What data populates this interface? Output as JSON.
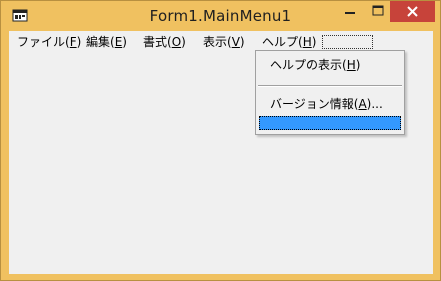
{
  "window": {
    "title": "Form1.MainMenu1",
    "icons": {
      "app": "form-app-icon",
      "minimize": "minimize-icon",
      "maximize": "maximize-icon",
      "close": "close-icon"
    },
    "colors": {
      "frame": "#f0c160",
      "close_button": "#c7433a",
      "client": "#f0f0f0",
      "highlight": "#3399ff"
    }
  },
  "menubar": {
    "items": [
      {
        "label_pre": "ファイル(",
        "mnemonic": "F",
        "label_post": ")"
      },
      {
        "label_pre": "編集(",
        "mnemonic": "E",
        "label_post": ")"
      },
      {
        "label_pre": "書式(",
        "mnemonic": "O",
        "label_post": ")"
      },
      {
        "label_pre": "表示(",
        "mnemonic": "V",
        "label_post": ")"
      },
      {
        "label_pre": "ヘルプ(",
        "mnemonic": "H",
        "label_post": ")"
      }
    ],
    "new_item_placeholder": ""
  },
  "help_menu": {
    "items": [
      {
        "label_pre": "ヘルプの表示(",
        "mnemonic": "H",
        "label_post": ")"
      },
      {
        "label_pre": "バージョン情報(",
        "mnemonic": "A",
        "label_post": ")..."
      }
    ],
    "new_item_placeholder": ""
  }
}
